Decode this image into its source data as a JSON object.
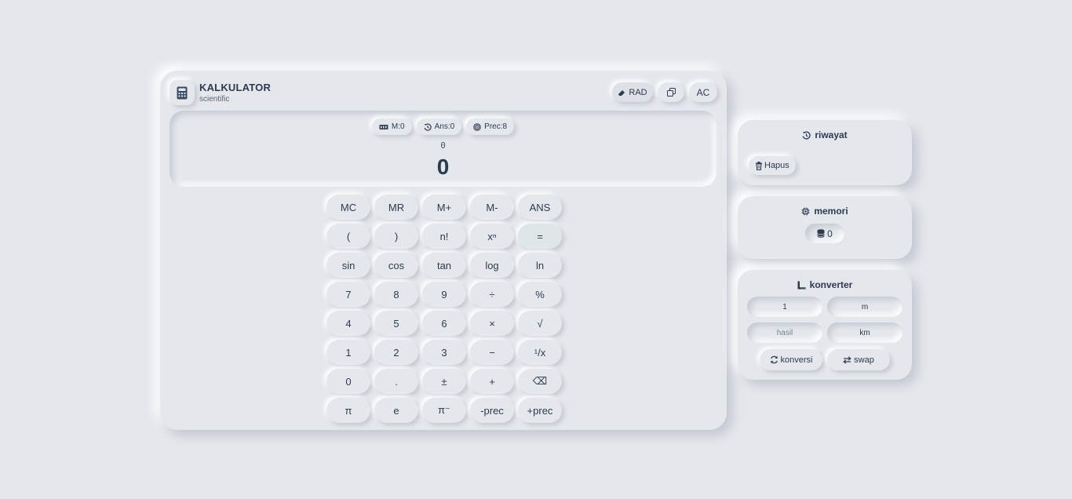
{
  "header": {
    "title": "KALKULATOR",
    "subtitle": "scientific",
    "rad_label": "RAD",
    "ac_label": "AC",
    "icons": [
      "calculator-icon",
      "eraser-icon",
      "copy-icon"
    ]
  },
  "display": {
    "chips": {
      "memory": "M:0",
      "ans": "Ans:0",
      "prec": "Prec:8"
    },
    "expression": "0",
    "result": "0"
  },
  "keys": [
    [
      "MC",
      "MR",
      "M+",
      "M-",
      "ANS"
    ],
    [
      "(",
      ")",
      "n!",
      "xⁿ",
      "="
    ],
    [
      "sin",
      "cos",
      "tan",
      "log",
      "ln"
    ],
    [
      "7",
      "8",
      "9",
      "÷",
      "%"
    ],
    [
      "4",
      "5",
      "6",
      "×",
      "√"
    ],
    [
      "1",
      "2",
      "3",
      "−",
      "¹/x"
    ],
    [
      "0",
      ".",
      "±",
      "+",
      "⌫"
    ],
    [
      "π",
      "e",
      "π⁻",
      "-prec",
      "+prec"
    ]
  ],
  "history": {
    "title": "riwayat",
    "clear_label": "Hapus"
  },
  "memory": {
    "title": "memori",
    "value": "0"
  },
  "converter": {
    "title": "konverter",
    "input_value": "1",
    "from_unit": "m",
    "result_placeholder": "hasil",
    "to_unit": "km",
    "convert_label": "konversi",
    "swap_label": "swap"
  },
  "colors": {
    "background": "#e4e7ec",
    "text": "#2e3a50",
    "equals_key": "#dfe6e6"
  }
}
